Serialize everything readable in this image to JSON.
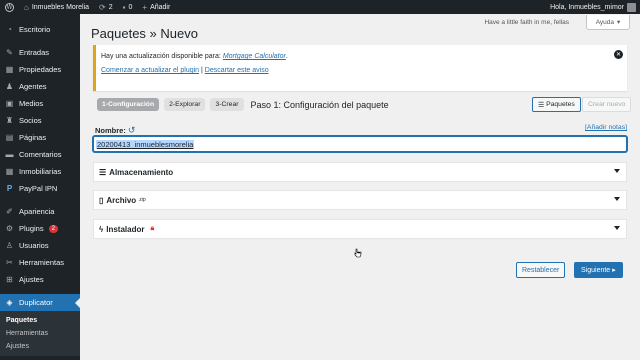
{
  "adminbar": {
    "site_name": "Inmuebles Morelia",
    "updates_count": "2",
    "comments_count": "0",
    "new_label": "Añadir",
    "greeting": "Hola, Inmuebles_mimor"
  },
  "sidebar": {
    "items": [
      {
        "label": "Escritorio",
        "icon": "dashboard-icon"
      },
      {
        "label": "Entradas",
        "icon": "pin-icon"
      },
      {
        "label": "Propiedades",
        "icon": "building-icon"
      },
      {
        "label": "Agentes",
        "icon": "person-icon"
      },
      {
        "label": "Medios",
        "icon": "media-icon"
      },
      {
        "label": "Socios",
        "icon": "group-icon"
      },
      {
        "label": "Páginas",
        "icon": "page-icon"
      },
      {
        "label": "Comentarios",
        "icon": "comment-icon"
      },
      {
        "label": "Inmobiliarias",
        "icon": "building-icon"
      },
      {
        "label": "PayPal IPN",
        "icon": "paypal-icon"
      },
      {
        "label": "Apariencia",
        "icon": "brush-icon"
      },
      {
        "label": "Plugins",
        "icon": "plug-icon",
        "badge": "2"
      },
      {
        "label": "Usuarios",
        "icon": "user-icon"
      },
      {
        "label": "Herramientas",
        "icon": "wrench-icon"
      },
      {
        "label": "Ajustes",
        "icon": "settings-icon"
      },
      {
        "label": "Duplicator",
        "icon": "duplicator-icon"
      }
    ],
    "submenu": [
      "Paquetes",
      "Herramientas",
      "Ajustes"
    ]
  },
  "header": {
    "title": "Paquetes » Nuevo",
    "quote": "Have a little faith in me, fellas",
    "help_label": "Ayuda"
  },
  "notice": {
    "text_prefix": "Hay una actualización disponible para: ",
    "plugin_link": "Mortgage Calculator",
    "text_suffix": ".",
    "update_link": "Comenzar a actualizar el plugin",
    "separator": " | ",
    "dismiss_link": "Descartar este aviso"
  },
  "steps": {
    "items": [
      "1-Configuración",
      "2-Explorar",
      "3-Crear"
    ],
    "title": "Paso 1: Configuración del paquete",
    "packages_button": "Paquetes",
    "new_button": "Crear nuevo"
  },
  "form": {
    "name_label": "Nombre:",
    "add_notes": "[Añadir notas]",
    "name_value": "20200413_inmueblesmorelia"
  },
  "panels": {
    "storage": "Almacenamiento",
    "archive": "Archivo",
    "archive_sup": "zip",
    "installer": "Instalador"
  },
  "actions": {
    "reset": "Restablecer",
    "next": "Siguiente"
  },
  "colors": {
    "accent": "#2271b1",
    "admin_dark": "#1d2327",
    "notice_border": "#dba617",
    "badge": "#d63638"
  }
}
